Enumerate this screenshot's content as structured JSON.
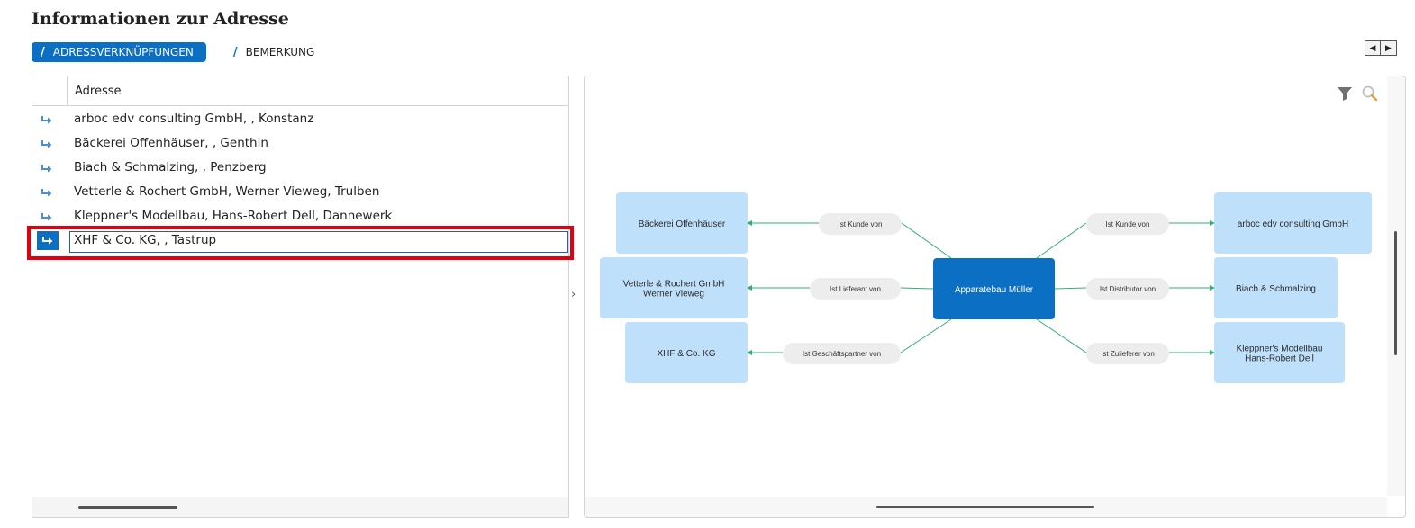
{
  "page": {
    "title": "Informationen zur Adresse"
  },
  "tabs": [
    {
      "label": "ADRESSVERKNÜPFUNGEN",
      "active": true
    },
    {
      "label": "BEMERKUNG",
      "active": false
    }
  ],
  "nav": {
    "prev_icon": "arrow-left",
    "next_icon": "arrow-right"
  },
  "list": {
    "header": "Adresse",
    "rows": [
      {
        "label": "arboc edv consulting GmbH,  , Konstanz",
        "selected": false
      },
      {
        "label": "Bäckerei Offenhäuser,  , Genthin",
        "selected": false
      },
      {
        "label": "Biach & Schmalzing,  , Penzberg",
        "selected": false
      },
      {
        "label": "Vetterle & Rochert GmbH, Werner Vieweg, Trulben",
        "selected": false
      },
      {
        "label": "Kleppner's Modellbau, Hans-Robert Dell, Dannewerk",
        "selected": false
      },
      {
        "label": "XHF & Co. KG,  , Tastrup",
        "selected": true
      }
    ]
  },
  "diagram": {
    "center": "Apparatebau Müller",
    "nodes": [
      {
        "lines": [
          "Bäckerei Offenhäuser"
        ],
        "relation": "Ist Kunde von"
      },
      {
        "lines": [
          "Vetterle & Rochert GmbH",
          "Werner Vieweg"
        ],
        "relation": "Ist Lieferant von"
      },
      {
        "lines": [
          "XHF & Co. KG"
        ],
        "relation": "Ist Geschäftspartner von"
      },
      {
        "lines": [
          "arboc edv consulting GmbH"
        ],
        "relation": "Ist Kunde von"
      },
      {
        "lines": [
          "Biach & Schmalzing"
        ],
        "relation": "Ist Distributor von"
      },
      {
        "lines": [
          "Kleppner's Modellbau",
          "Hans-Robert Dell"
        ],
        "relation": "Ist Zulieferer von"
      }
    ],
    "toolbar_icons": [
      "filter-icon",
      "search-icon"
    ]
  },
  "colors": {
    "accent": "#0b6fc4",
    "node_fill": "#bfe0fb",
    "center_fill": "#0b6fc4",
    "edge": "#2fb07a",
    "pill_fill": "#ededed",
    "selection_outline": "#e00010",
    "link_icon": "#4a8fd6"
  }
}
